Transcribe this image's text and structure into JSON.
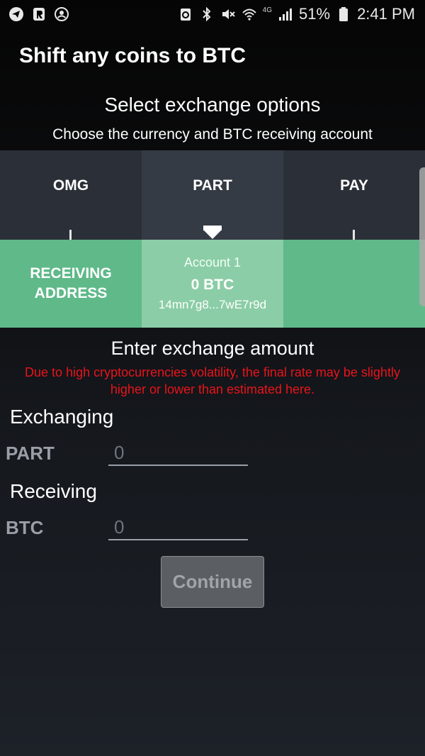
{
  "status_bar": {
    "battery_percent": "51%",
    "time": "2:41 PM",
    "network": "4G",
    "icons": [
      "telegram-icon",
      "r-app-icon",
      "account-circle-icon",
      "sync-icon",
      "bluetooth-icon",
      "mute-icon",
      "wifi-icon",
      "signal-icon",
      "battery-icon"
    ]
  },
  "header": {
    "title": "Shift any coins to BTC"
  },
  "options": {
    "heading": "Select exchange options",
    "subheading": "Choose the currency and BTC receiving account"
  },
  "currencies": [
    {
      "label": "OMG",
      "selected": false
    },
    {
      "label": "PART",
      "selected": true
    },
    {
      "label": "PAY",
      "selected": false
    }
  ],
  "receiving": {
    "label_line1": "RECEIVING",
    "label_line2": "ADDRESS",
    "account": {
      "name": "Account 1",
      "balance": "0 BTC",
      "address": "14mn7g8...7wE7r9d"
    }
  },
  "amount": {
    "heading": "Enter exchange amount",
    "warning": "Due to high cryptocurrencies volatility, the final rate may be slightly higher or lower than estimated here.",
    "exchanging_label": "Exchanging",
    "exchanging_currency": "PART",
    "exchanging_placeholder": "0",
    "receiving_label": "Receiving",
    "receiving_currency": "BTC",
    "receiving_placeholder": "0"
  },
  "actions": {
    "continue_label": "Continue"
  },
  "colors": {
    "accent_green": "#5fb989",
    "selected_account": "#8bcda6",
    "warning_red": "#e8141b"
  }
}
